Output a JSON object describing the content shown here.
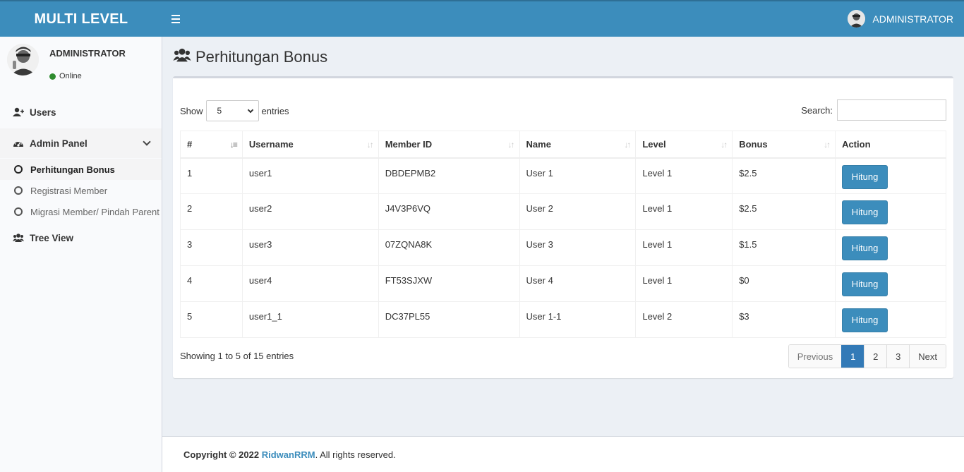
{
  "header": {
    "logo": "MULTI LEVEL",
    "user": "ADMINISTRATOR"
  },
  "sidebar": {
    "user": {
      "name": "ADMINISTRATOR",
      "status": "Online"
    },
    "items": [
      {
        "label": "Users",
        "icon": "user-plus-icon"
      },
      {
        "label": "Admin Panel",
        "icon": "dashboard-icon"
      },
      {
        "label": "Tree View",
        "icon": "users-icon"
      }
    ],
    "submenu": [
      {
        "label": "Perhitungan Bonus",
        "active": true
      },
      {
        "label": "Registrasi Member"
      },
      {
        "label": "Migrasi Member/ Pindah Parent"
      }
    ]
  },
  "page": {
    "title": "Perhitungan Bonus"
  },
  "table_controls": {
    "show_label": "Show",
    "entries_value": "5",
    "entries_label": "entries",
    "search_label": "Search:",
    "search_value": ""
  },
  "table": {
    "columns": [
      "#",
      "Username",
      "Member ID",
      "Name",
      "Level",
      "Bonus",
      "Action"
    ],
    "rows": [
      {
        "no": "1",
        "username": "user1",
        "member_id": "DBDEPMB2",
        "name": "User 1",
        "level": "Level 1",
        "bonus": "$2.5",
        "action": "Hitung"
      },
      {
        "no": "2",
        "username": "user2",
        "member_id": "J4V3P6VQ",
        "name": "User 2",
        "level": "Level 1",
        "bonus": "$2.5",
        "action": "Hitung"
      },
      {
        "no": "3",
        "username": "user3",
        "member_id": "07ZQNA8K",
        "name": "User 3",
        "level": "Level 1",
        "bonus": "$1.5",
        "action": "Hitung"
      },
      {
        "no": "4",
        "username": "user4",
        "member_id": "FT53SJXW",
        "name": "User 4",
        "level": "Level 1",
        "bonus": "$0",
        "action": "Hitung"
      },
      {
        "no": "5",
        "username": "user1_1",
        "member_id": "DC37PL55",
        "name": "User 1-1",
        "level": "Level 2",
        "bonus": "$3",
        "action": "Hitung"
      }
    ],
    "info": "Showing 1 to 5 of 15 entries"
  },
  "pagination": {
    "previous": "Previous",
    "pages": [
      "1",
      "2",
      "3"
    ],
    "current": "1",
    "next": "Next"
  },
  "footer": {
    "prefix": "Copyright © 2022",
    "link": "RidwanRRM",
    "suffix": ". All rights reserved."
  },
  "colors": {
    "primary": "#3c8dbc",
    "online": "#2e8b2e",
    "background": "#ecf0f5"
  }
}
